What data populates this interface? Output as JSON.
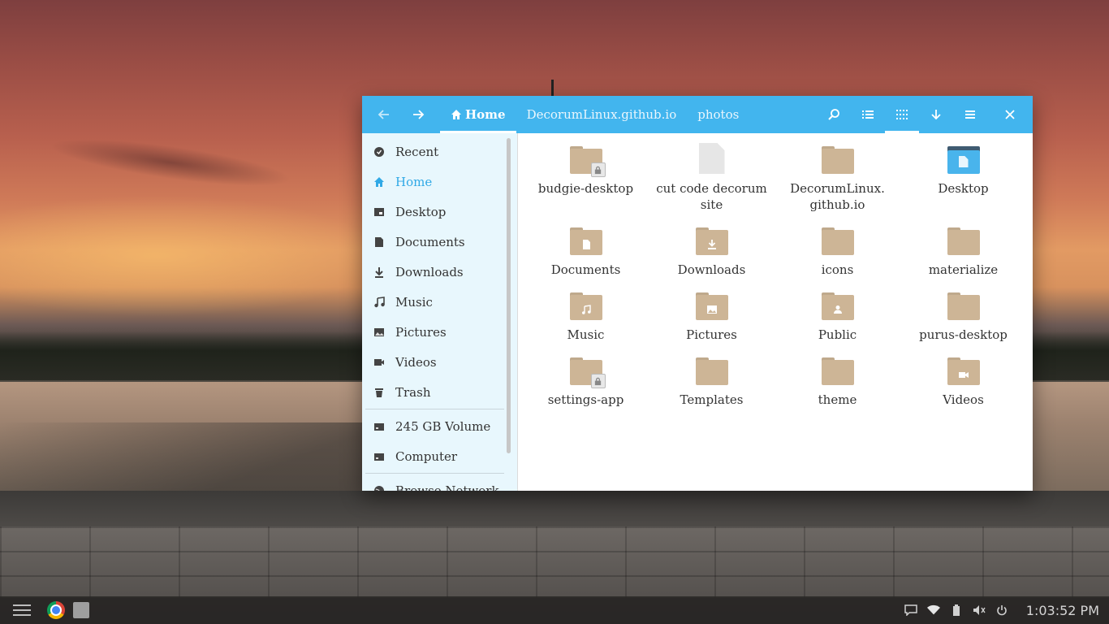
{
  "window": {
    "breadcrumbs": [
      {
        "label": "Home",
        "active": true
      },
      {
        "label": "DecorumLinux.github.io",
        "active": false
      },
      {
        "label": "photos",
        "active": false
      }
    ],
    "header_icons": [
      "search-icon",
      "list-view-icon",
      "grid-view-icon",
      "sort-down-icon",
      "menu-icon",
      "close-icon"
    ],
    "active_view": "grid-view-icon",
    "accent_color": "#42b5ee"
  },
  "sidebar": {
    "items": [
      {
        "label": "Recent",
        "icon": "clock-icon"
      },
      {
        "label": "Home",
        "icon": "home-icon",
        "selected": true
      },
      {
        "label": "Desktop",
        "icon": "desktop-icon"
      },
      {
        "label": "Documents",
        "icon": "document-icon"
      },
      {
        "label": "Downloads",
        "icon": "download-icon"
      },
      {
        "label": "Music",
        "icon": "music-icon"
      },
      {
        "label": "Pictures",
        "icon": "pictures-icon"
      },
      {
        "label": "Videos",
        "icon": "video-icon"
      },
      {
        "label": "Trash",
        "icon": "trash-icon"
      }
    ],
    "devices": [
      {
        "label": "245 GB Volume",
        "icon": "drive-icon"
      },
      {
        "label": "Computer",
        "icon": "computer-icon"
      }
    ],
    "network": [
      {
        "label": "Browse Network",
        "icon": "network-icon"
      }
    ]
  },
  "files": [
    {
      "name": "budgie-desktop",
      "type": "folder-locked"
    },
    {
      "name": "cut code decorum site",
      "type": "file"
    },
    {
      "name": "DecorumLinux. github.io",
      "type": "folder"
    },
    {
      "name": "Desktop",
      "type": "desktop-folder"
    },
    {
      "name": "Documents",
      "type": "folder-documents"
    },
    {
      "name": "Downloads",
      "type": "folder-downloads"
    },
    {
      "name": "icons",
      "type": "folder"
    },
    {
      "name": "materialize",
      "type": "folder"
    },
    {
      "name": "Music",
      "type": "folder-music"
    },
    {
      "name": "Pictures",
      "type": "folder-pictures"
    },
    {
      "name": "Public",
      "type": "folder-public"
    },
    {
      "name": "purus-desktop",
      "type": "folder"
    },
    {
      "name": "settings-app",
      "type": "folder-locked"
    },
    {
      "name": "Templates",
      "type": "folder"
    },
    {
      "name": "theme",
      "type": "folder"
    },
    {
      "name": "Videos",
      "type": "folder-videos"
    }
  ],
  "taskbar": {
    "clock": "1:03:52 PM",
    "tray_icons": [
      "notification-icon",
      "wifi-icon",
      "battery-icon",
      "volume-icon",
      "power-icon"
    ]
  }
}
